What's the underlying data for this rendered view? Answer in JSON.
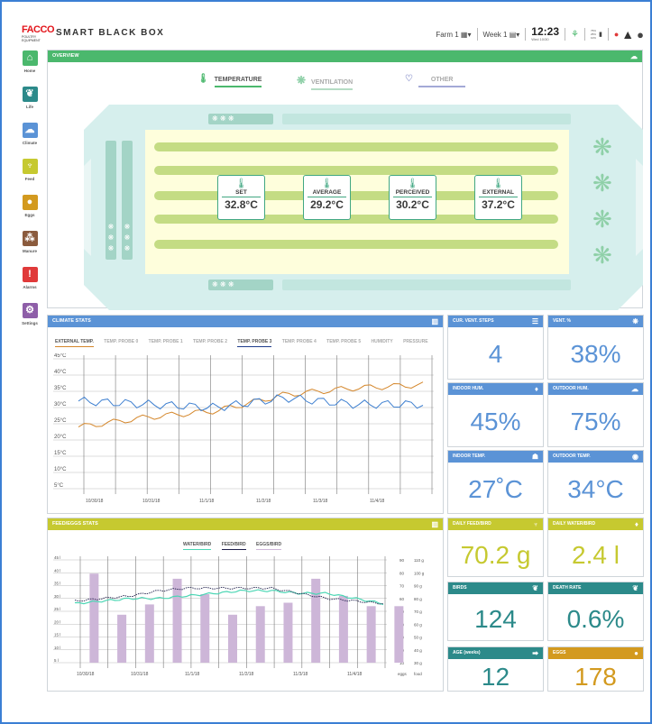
{
  "header": {
    "app_title": "SMART BLACK BOX",
    "logo_text": "FACCO",
    "logo_sub": "POULTRY EQUIPMENT",
    "farm": "Farm 1",
    "week": "Week 1",
    "time": "12:23",
    "date": "Wed 10/30",
    "levels": [
      "75%",
      "25%",
      "10%"
    ]
  },
  "sidebar": {
    "items": [
      {
        "label": "Home",
        "color": "#4bb86d"
      },
      {
        "label": "Life",
        "color": "#2c8a8a"
      },
      {
        "label": "Climate",
        "color": "#5b93d6"
      },
      {
        "label": "Feed",
        "color": "#c6c930"
      },
      {
        "label": "Eggs",
        "color": "#d39a1f"
      },
      {
        "label": "Manure",
        "color": "#8b5b3d"
      },
      {
        "label": "Alarms",
        "color": "#e03a3a"
      },
      {
        "label": "Settings",
        "color": "#8e5ea8"
      }
    ]
  },
  "overview": {
    "title": "OVERVIEW",
    "tabs": [
      "TEMPERATURE",
      "VENTILATION",
      "OTHER"
    ],
    "stats": [
      {
        "label": "SET",
        "value": "32.8°C"
      },
      {
        "label": "AVERAGE",
        "value": "29.2°C"
      },
      {
        "label": "PERCEIVED",
        "value": "30.2°C"
      },
      {
        "label": "EXTERNAL",
        "value": "37.2°C"
      }
    ]
  },
  "climate": {
    "title": "CLIMATE STATS",
    "legend": [
      "EXTERNAL TEMP.",
      "TEMP. PROBE 0",
      "TEMP. PROBE 1",
      "TEMP. PROBE 2",
      "TEMP. PROBE 3",
      "TEMP. PROBE 4",
      "TEMP. PROBE 5",
      "HUMIDITY",
      "PRESSURE"
    ],
    "y_ticks": [
      "45°C",
      "40°C",
      "35°C",
      "30°C",
      "25°C",
      "20°C",
      "15°C",
      "10°C",
      "5°C"
    ],
    "x_ticks": [
      "10/30/18",
      "10/31/18",
      "11/1/18",
      "11/2/18",
      "11/3/18",
      "11/4/18"
    ]
  },
  "feed": {
    "title": "FEED/EGGS STATS",
    "legend": [
      "WATER/BIRD",
      "FEED/BIRD",
      "EGGS/BIRD"
    ],
    "y_left": [
      "45 l",
      "40 l",
      "35 l",
      "30 l",
      "25 l",
      "20 l",
      "15 l",
      "10 l",
      "5 l"
    ],
    "y_mid": [
      "90",
      "80",
      "70",
      "60",
      "50",
      "40",
      "30",
      "20",
      "10"
    ],
    "y_right": [
      "110 g",
      "100 g",
      "90 g",
      "80 g",
      "70 g",
      "60 g",
      "50 g",
      "40 g",
      "30 g"
    ],
    "x_ticks": [
      "10/30/18",
      "10/31/18",
      "11/1/18",
      "11/2/18",
      "11/3/18",
      "11/4/18"
    ],
    "bottom_mid": "eggs",
    "bottom_right": "food"
  },
  "kpis": {
    "vent_steps": {
      "label": "CUR. VENT. STEPS",
      "value": "4"
    },
    "vent_pct": {
      "label": "VENT. %",
      "value": "38%"
    },
    "indoor_hum": {
      "label": "INDOOR HUM.",
      "value": "45%"
    },
    "outdoor_hum": {
      "label": "OUTDOOR HUM.",
      "value": "75%"
    },
    "indoor_temp": {
      "label": "INDOOR TEMP.",
      "value": "27˚C"
    },
    "outdoor_temp": {
      "label": "OUTDOOR TEMP.",
      "value": "34°C"
    },
    "daily_feed": {
      "label": "DAILY FEED/BIRD",
      "value": "70.2 g"
    },
    "daily_water": {
      "label": "DAILY WATER/BIRD",
      "value": "2.4 l"
    },
    "birds": {
      "label": "BIRDS",
      "value": "124"
    },
    "death_rate": {
      "label": "DEATH RATE",
      "value": "0.6%"
    },
    "age": {
      "label": "AGE (weeks)",
      "value": "12"
    },
    "eggs": {
      "label": "EGGS",
      "value": "178"
    }
  },
  "chart_data": [
    {
      "type": "line",
      "x": [
        "10/30/18",
        "10/31/18",
        "11/1/18",
        "11/2/18",
        "11/3/18",
        "11/4/18"
      ],
      "ylim": [
        5,
        45
      ],
      "series": [
        {
          "name": "EXTERNAL TEMP.",
          "values": [
            24,
            27,
            29,
            34,
            36,
            37
          ],
          "color": "#d4862a"
        },
        {
          "name": "TEMP. PROBE 3",
          "values": [
            32,
            31,
            30,
            33,
            31,
            31
          ],
          "color": "#3d7fd0"
        }
      ]
    },
    {
      "type": "bar",
      "x": [
        "10/30/18",
        "10/31/18",
        "11/1/18",
        "11/2/18",
        "11/3/18",
        "11/4/18"
      ],
      "series": [
        {
          "name": "EGGS/BIRD",
          "values": [
            52,
            28,
            34,
            49,
            40,
            28,
            33,
            35,
            49,
            39,
            33,
            33
          ],
          "color": "#cdb6d8"
        },
        {
          "name": "WATER/BIRD",
          "values": [
            28,
            29,
            30,
            30,
            31,
            32,
            33,
            33,
            32,
            32,
            30,
            28
          ],
          "color": "#4bd6b4"
        },
        {
          "name": "FEED/BIRD",
          "values": [
            29,
            30,
            31,
            33,
            34,
            34,
            34,
            34,
            32,
            30,
            29,
            28
          ],
          "color": "#1e1e4a"
        }
      ]
    }
  ]
}
